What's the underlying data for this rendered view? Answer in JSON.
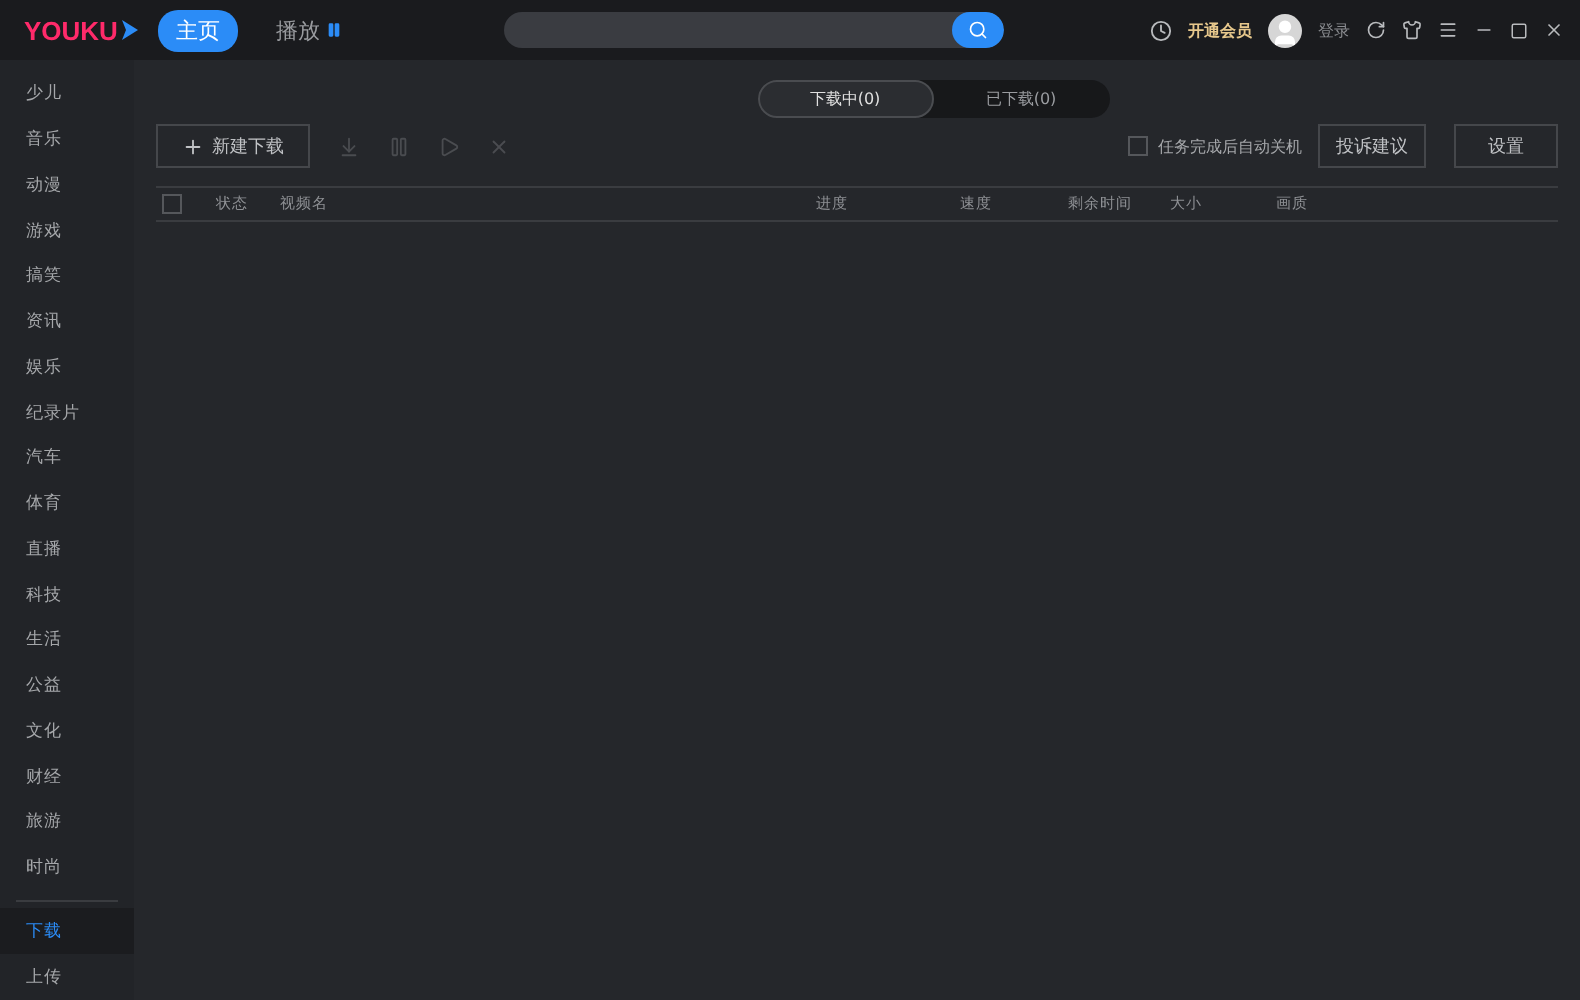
{
  "header": {
    "logo": "YOUKU",
    "nav": [
      {
        "label": "主页",
        "selected": true
      },
      {
        "label": "播放",
        "selected": false
      }
    ],
    "vip": "开通会员",
    "login": "登录"
  },
  "sidebar": {
    "items": [
      {
        "label": "少儿",
        "selected": false
      },
      {
        "label": "音乐",
        "selected": false
      },
      {
        "label": "动漫",
        "selected": false
      },
      {
        "label": "游戏",
        "selected": false
      },
      {
        "label": "搞笑",
        "selected": false
      },
      {
        "label": "资讯",
        "selected": false
      },
      {
        "label": "娱乐",
        "selected": false
      },
      {
        "label": "纪录片",
        "selected": false
      },
      {
        "label": "汽车",
        "selected": false
      },
      {
        "label": "体育",
        "selected": false
      },
      {
        "label": "直播",
        "selected": false
      },
      {
        "label": "科技",
        "selected": false
      },
      {
        "label": "生活",
        "selected": false
      },
      {
        "label": "公益",
        "selected": false
      },
      {
        "label": "文化",
        "selected": false
      },
      {
        "label": "财经",
        "selected": false
      },
      {
        "label": "旅游",
        "selected": false
      },
      {
        "label": "时尚",
        "selected": false
      }
    ],
    "bottom_items": [
      {
        "label": "下载",
        "selected": true
      },
      {
        "label": "上传",
        "selected": false
      }
    ]
  },
  "tabs": [
    {
      "label": "下载中(0)",
      "selected": true
    },
    {
      "label": "已下载(0)",
      "selected": false
    }
  ],
  "toolbar": {
    "new_download": "新建下载",
    "shutdown_option": {
      "label": "任务完成后自动关机",
      "checked": false
    },
    "buttons": [
      "投诉建议",
      "设置"
    ]
  },
  "table": {
    "select_all": {
      "checked": false
    },
    "columns": [
      "状态",
      "视频名",
      "进度",
      "速度",
      "剩余时间",
      "大小",
      "画质"
    ]
  }
}
